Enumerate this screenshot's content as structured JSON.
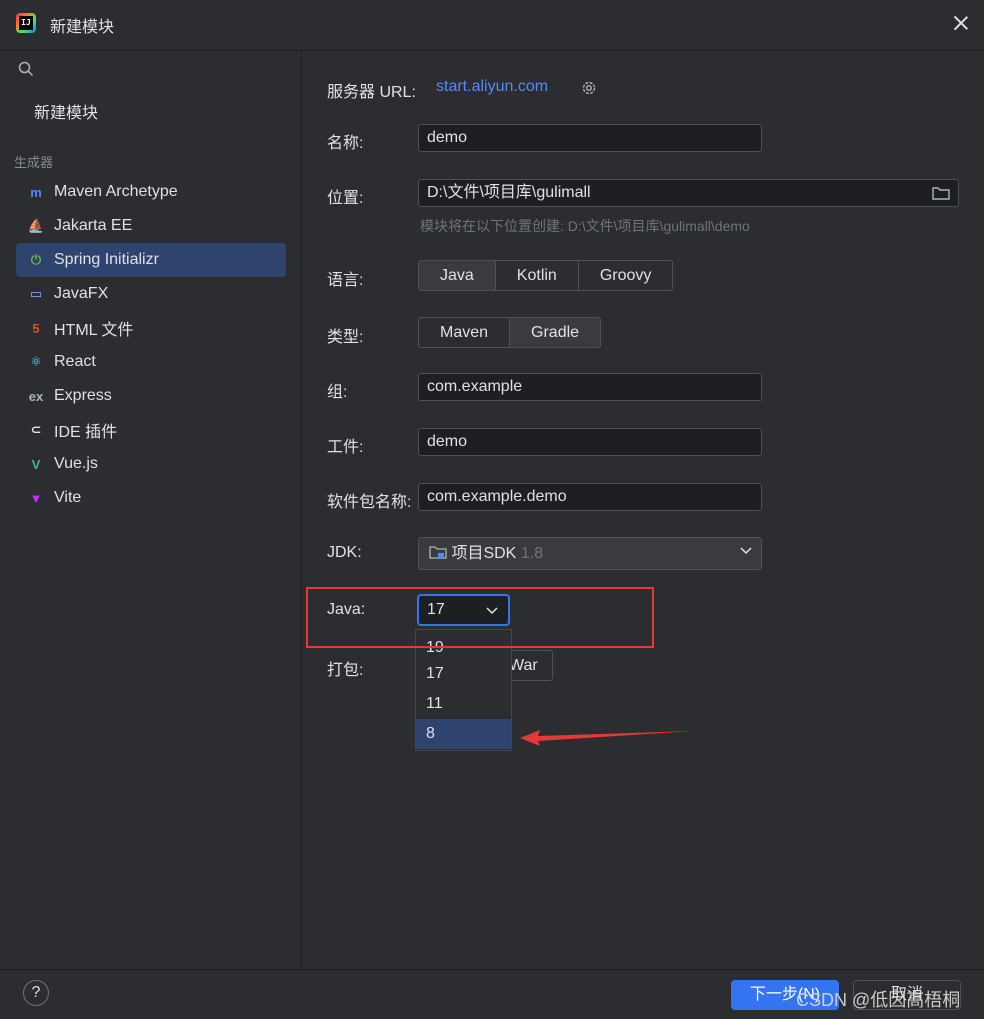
{
  "window": {
    "title": "新建模块"
  },
  "sidebar": {
    "top_item": "新建模块",
    "group_label": "生成器",
    "generators": [
      {
        "label": "Maven Archetype",
        "icon": "maven-icon",
        "glyph": "m",
        "color": "#4b8df8"
      },
      {
        "label": "Jakarta EE",
        "icon": "jakarta-ee-icon",
        "glyph": "⛵",
        "color": "#f1a33c"
      },
      {
        "label": "Spring Initializr",
        "icon": "spring-icon",
        "glyph": "⏻",
        "color": "#6db33f"
      },
      {
        "label": "JavaFX",
        "icon": "javafx-icon",
        "glyph": "▭",
        "color": "#8ab4f8"
      },
      {
        "label": "HTML 文件",
        "icon": "html5-icon",
        "glyph": "5",
        "color": "#e44d26"
      },
      {
        "label": "React",
        "icon": "react-icon",
        "glyph": "⚛",
        "color": "#61dafb"
      },
      {
        "label": "Express",
        "icon": "express-icon",
        "glyph": "ex",
        "color": "#aeb3bb"
      },
      {
        "label": "IDE 插件",
        "icon": "plugin-icon",
        "glyph": "⊂",
        "color": "#dfe1e5"
      },
      {
        "label": "Vue.js",
        "icon": "vue-icon",
        "glyph": "V",
        "color": "#41b883"
      },
      {
        "label": "Vite",
        "icon": "vite-icon",
        "glyph": "▼",
        "color": "#bd34fe"
      }
    ],
    "selected_index": 2
  },
  "form": {
    "server_url_label": "服务器 URL:",
    "server_url": "start.aliyun.com",
    "name_label": "名称:",
    "name_value": "demo",
    "location_label": "位置:",
    "location_value": "D:\\文件\\项目库\\gulimall",
    "location_hint": "模块将在以下位置创建: D:\\文件\\项目库\\gulimall\\demo",
    "language_label": "语言:",
    "languages": [
      "Java",
      "Kotlin",
      "Groovy"
    ],
    "language_selected": "Java",
    "type_label": "类型:",
    "types": [
      "Maven",
      "Gradle"
    ],
    "type_selected": "Gradle",
    "group_label": "组:",
    "group_value": "com.example",
    "artifact_label": "工件:",
    "artifact_value": "demo",
    "package_label": "软件包名称:",
    "package_value": "com.example.demo",
    "jdk_label": "JDK:",
    "jdk_name": "项目SDK",
    "jdk_version": "1.8",
    "java_label": "Java:",
    "java_selected": "17",
    "java_options": [
      "19",
      "17",
      "11",
      "8"
    ],
    "java_highlighted": "8",
    "packaging_label": "打包:",
    "packaging_visible_option": "War"
  },
  "footer": {
    "help": "?",
    "next": "下一步(N)",
    "cancel": "取消",
    "watermark": "CSDN @低因高梧桐"
  },
  "colors": {
    "accent": "#3574f0",
    "link": "#548af7",
    "selection": "#2e436e",
    "annotation_red": "#e53935"
  }
}
